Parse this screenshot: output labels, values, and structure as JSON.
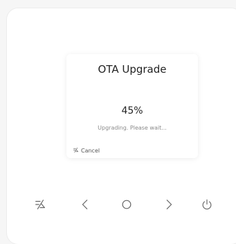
{
  "dialog": {
    "title": "OTA Upgrade",
    "progress_text": "45%",
    "progress_value": 0.45,
    "status": "Upgrading. Please wait...",
    "cancel_label": "Cancel",
    "cancel_icon": "cancel-slash-icon"
  },
  "navbar": {
    "items": [
      {
        "name": "cancel",
        "icon": "cancel-slash-icon"
      },
      {
        "name": "back",
        "icon": "chevron-left-icon"
      },
      {
        "name": "home",
        "icon": "circle-home-icon"
      },
      {
        "name": "forward",
        "icon": "chevron-right-icon"
      },
      {
        "name": "power",
        "icon": "power-icon"
      }
    ]
  },
  "colors": {
    "background": "#f6f6f6",
    "panel": "#ffffff",
    "text": "#222222",
    "muted": "#8a8a8a",
    "icon": "#666666"
  }
}
